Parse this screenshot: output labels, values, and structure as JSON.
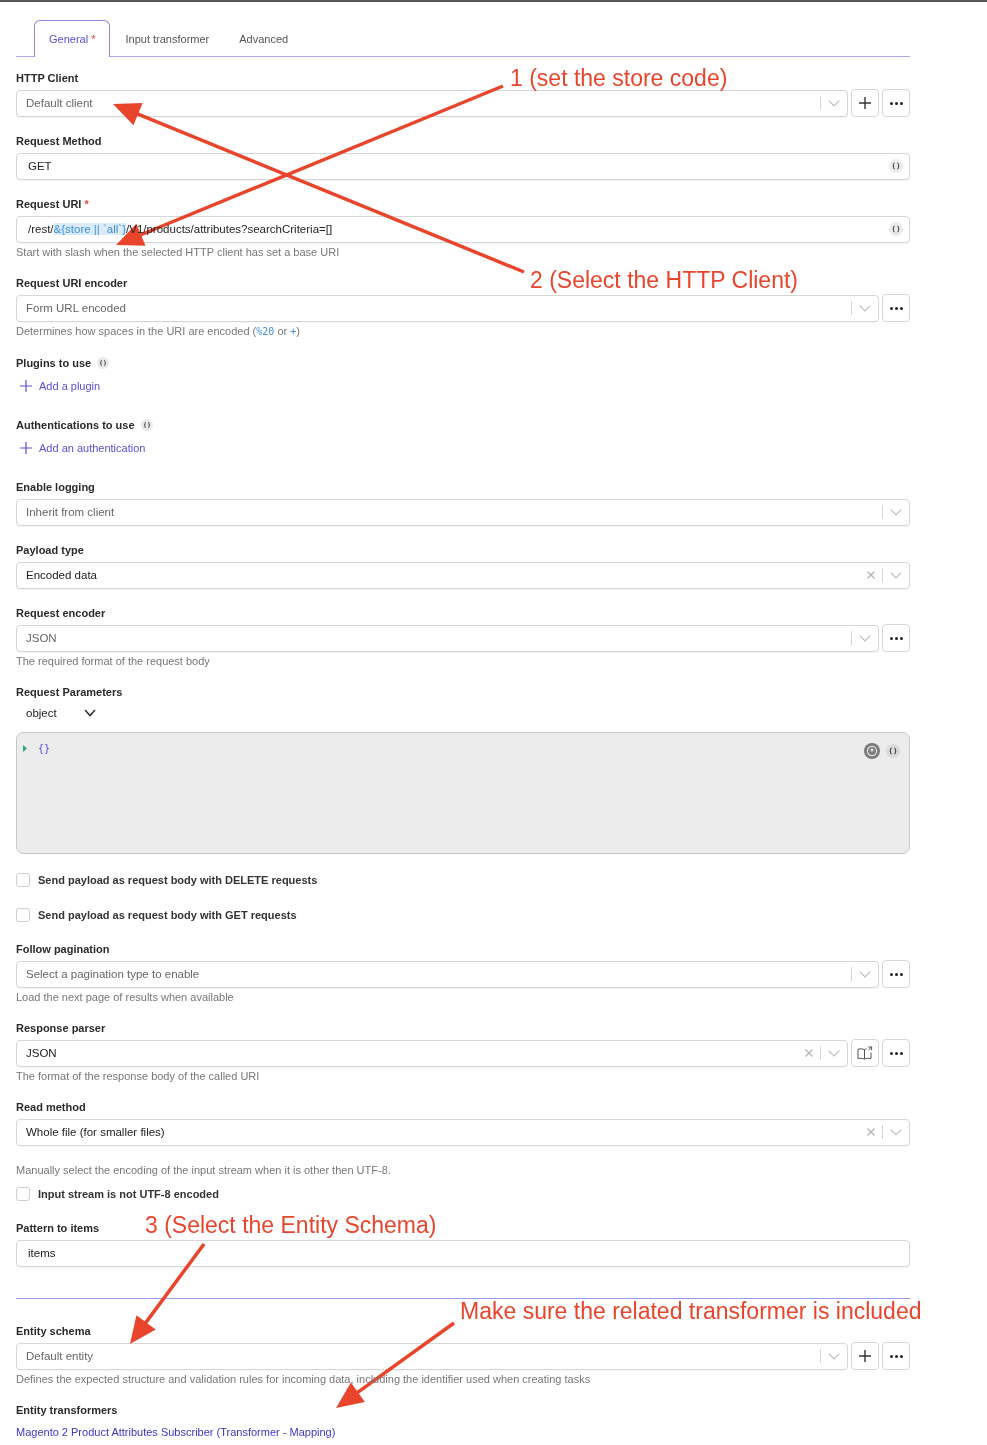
{
  "tabs": [
    {
      "label": "General",
      "required_mark": "*",
      "selected": true
    },
    {
      "label": "Input transformer",
      "selected": false
    },
    {
      "label": "Advanced",
      "selected": false
    }
  ],
  "sections": [
    {
      "fields": [
        {
          "kind": "select",
          "label": "HTTP Client",
          "placeholder": "Default client",
          "clearable": false,
          "actions": [
            {
              "kind": "add"
            },
            {
              "kind": "more"
            }
          ]
        },
        {
          "kind": "text",
          "label": "Request Method",
          "value": "GET",
          "expression": true
        },
        {
          "kind": "text",
          "label": "Request URI",
          "required_mark": "*",
          "value_parts": [
            {
              "kind": "plain",
              "text": "/rest/"
            },
            {
              "kind": "expression",
              "text": "&{store || `all`}"
            },
            {
              "kind": "plain",
              "text": "/V1/products/attributes?searchCriteria=[]"
            }
          ],
          "expression": true,
          "help": "Start with slash when the selected HTTP client has set a base URI"
        },
        {
          "kind": "select",
          "label": "Request URI encoder",
          "placeholder": "Form URL encoded",
          "clearable": false,
          "actions": [
            {
              "kind": "more"
            }
          ],
          "help_parts": [
            {
              "kind": "plain",
              "text": "Determines how spaces in the URI are encoded ("
            },
            {
              "kind": "code",
              "text": "%20"
            },
            {
              "kind": "plain",
              "text": " or "
            },
            {
              "kind": "code",
              "text": "+"
            },
            {
              "kind": "plain",
              "text": ")"
            }
          ]
        },
        {
          "kind": "add-list",
          "label": "Plugins to use",
          "expression": true,
          "action_label": "Add a plugin"
        },
        {
          "kind": "add-list",
          "label": "Authentications to use",
          "expression": true,
          "action_label": "Add an authentication"
        },
        {
          "kind": "select",
          "label": "Enable logging",
          "placeholder": "Inherit from client",
          "clearable": false
        },
        {
          "kind": "select",
          "label": "Payload type",
          "value": "Encoded data",
          "clearable": true
        },
        {
          "kind": "select",
          "label": "Request encoder",
          "placeholder": "JSON",
          "clearable": false,
          "actions": [
            {
              "kind": "more"
            }
          ],
          "help": "The required format of the request body"
        },
        {
          "kind": "code-editor",
          "label": "Request Parameters",
          "type_value": "object",
          "editor_text": "{}",
          "expression": true
        },
        {
          "kind": "checkbox",
          "label": "Send payload as request body with DELETE requests",
          "checked": false
        },
        {
          "kind": "checkbox",
          "label": "Send payload as request body with GET requests",
          "checked": false
        },
        {
          "kind": "select",
          "label": "Follow pagination",
          "placeholder": "Select a pagination type to enable",
          "clearable": false,
          "actions": [
            {
              "kind": "more"
            }
          ],
          "help": "Load the next page of results when available"
        },
        {
          "kind": "select",
          "label": "Response parser",
          "value": "JSON",
          "clearable": true,
          "actions": [
            {
              "kind": "docs"
            },
            {
              "kind": "more"
            }
          ],
          "help": "The format of the response body of the called URI"
        },
        {
          "kind": "select",
          "label": "Read method",
          "value": "Whole file (for smaller files)",
          "clearable": true
        },
        {
          "kind": "note",
          "text": "Manually select the encoding of the input stream when it is other then UTF-8."
        },
        {
          "kind": "checkbox",
          "label": "Input stream is not UTF-8 encoded",
          "checked": false
        },
        {
          "kind": "text",
          "label": "Pattern to items",
          "value": "items",
          "expression": false
        }
      ]
    },
    {
      "fields": [
        {
          "kind": "select",
          "label": "Entity schema",
          "placeholder": "Default entity",
          "clearable": false,
          "actions": [
            {
              "kind": "add"
            },
            {
              "kind": "more"
            }
          ],
          "help": "Defines the expected structure and validation rules for incoming data, including the identifier used when creating tasks"
        },
        {
          "kind": "links",
          "label": "Entity transformers",
          "links": [
            "Magento 2 Product Attributes Subscriber (Transformer - Mapping)"
          ]
        }
      ]
    }
  ],
  "annotations": [
    {
      "text": "1 (set the store code)"
    },
    {
      "text": "2 (Select the HTTP Client)"
    },
    {
      "text": "3 (Select the Entity Schema)"
    },
    {
      "text": "Make sure the related transformer is included"
    }
  ]
}
